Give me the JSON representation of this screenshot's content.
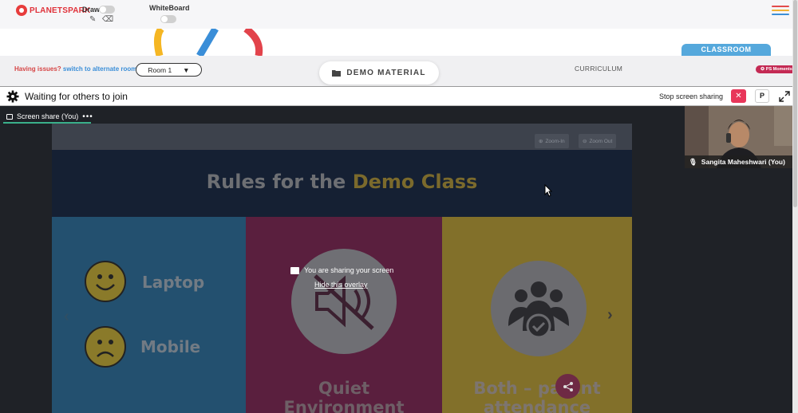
{
  "topbar": {
    "logo_text": "PLANETSPARK",
    "draw_label": "Draw",
    "whiteboard_label": "WhiteBoard"
  },
  "subbar": {
    "issues_text": "Having issues?",
    "alternate_room_link": "switch to alternate room",
    "room_select": "Room 1",
    "demo_material": "DEMO MATERIAL",
    "curriculum": "CURRICULUM",
    "classroom": "CLASSROOM",
    "ps_moments": "PS Moments"
  },
  "meeting": {
    "status_title": "Waiting for others to join",
    "stop_sharing_label": "Stop screen sharing",
    "p_button": "P",
    "tab_label": "Screen share (You)",
    "tab_more": "•••"
  },
  "shared_slide": {
    "zoom_in": "Zoom-In",
    "zoom_out": "Zoom Out",
    "title_part1": "Rules for the ",
    "title_part2": "Demo Class",
    "laptop": "Laptop",
    "mobile": "Mobile",
    "quiet_line1": "Quiet",
    "quiet_line2": "Environment",
    "both_line1": "Both – parent",
    "both_line2": "attendance"
  },
  "overlay": {
    "message": "You are sharing your screen",
    "hide_link": "Hide this overlay"
  },
  "participant": {
    "name": "Sangita Maheshwari (You)"
  },
  "colors": {
    "brand_red": "#e0323a",
    "classroom_blue": "#55a8dc",
    "stop_red": "#e8365a",
    "tab_green": "#3ab08a"
  }
}
